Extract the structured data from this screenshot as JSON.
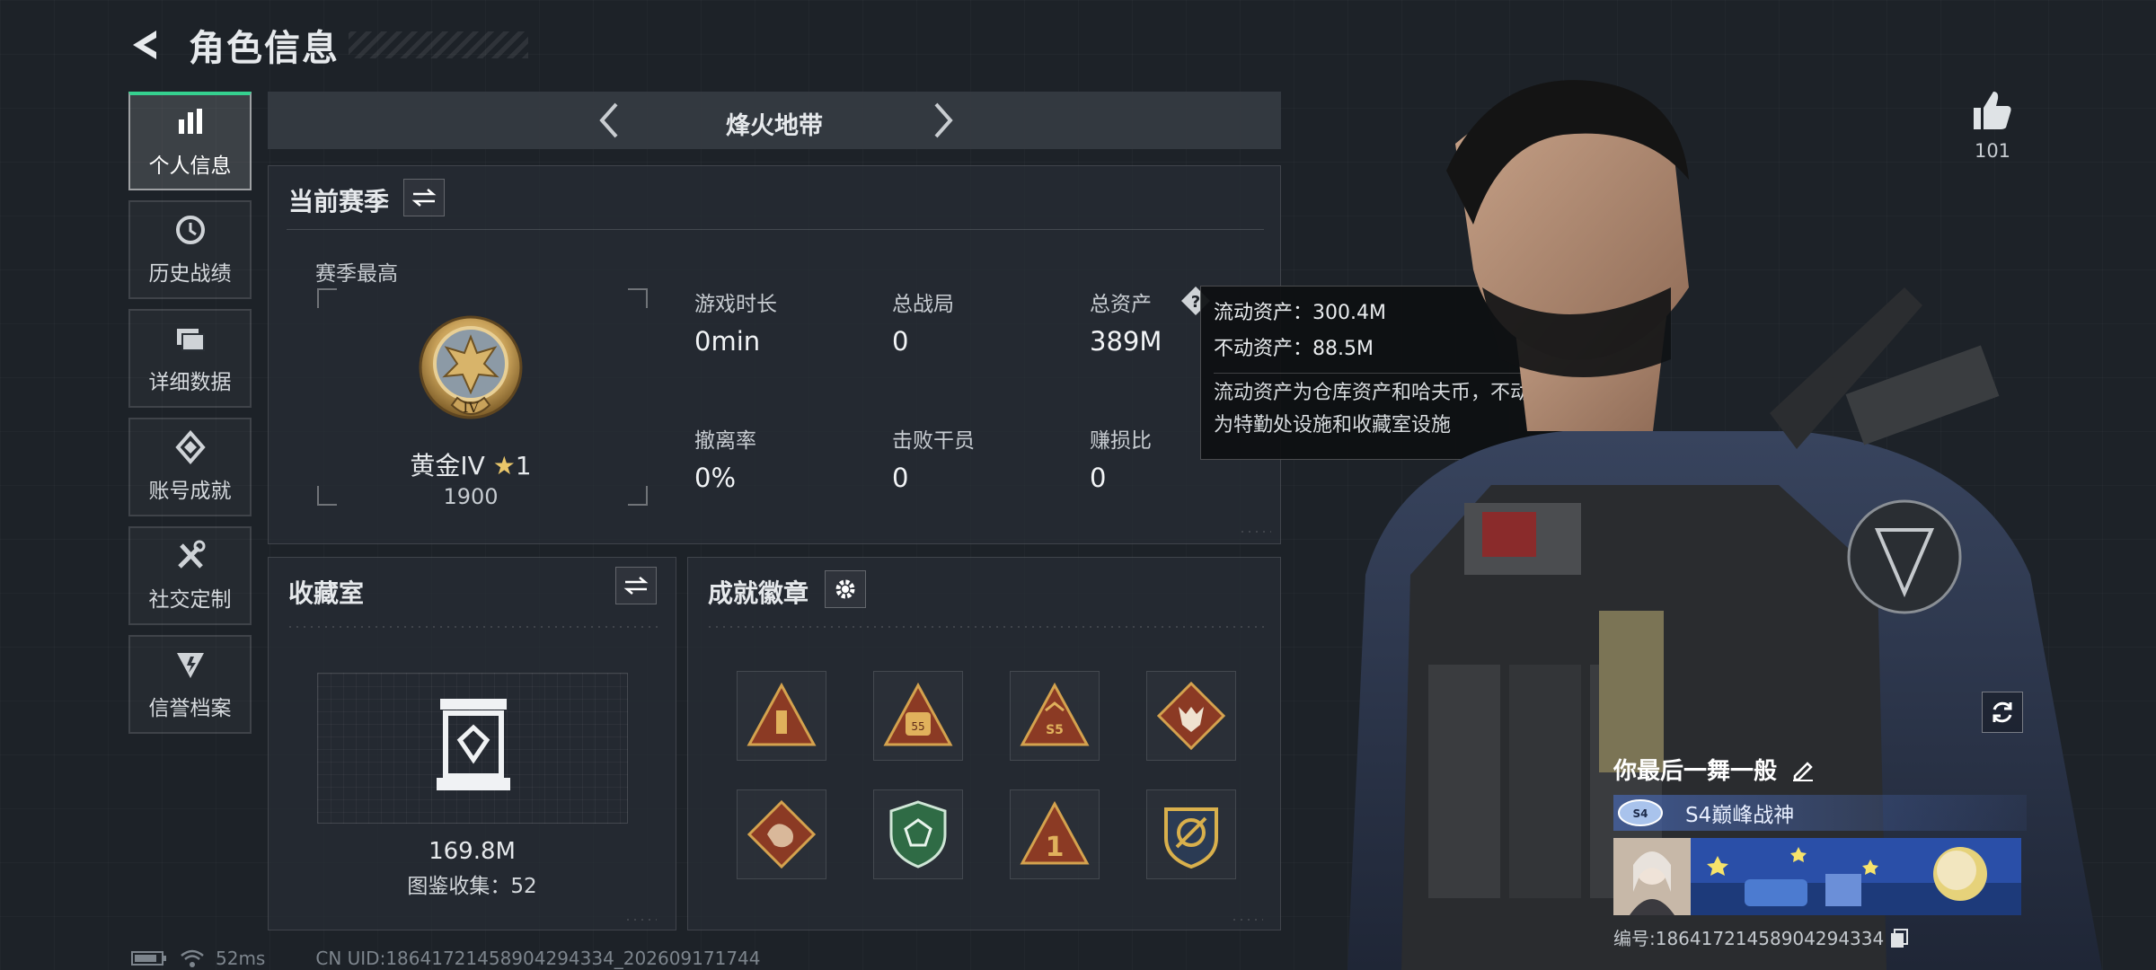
{
  "header": {
    "title": "角色信息"
  },
  "side_nav": {
    "items": [
      {
        "label": "个人信息",
        "icon": "bar-chart-icon",
        "active": true
      },
      {
        "label": "历史战绩",
        "icon": "clock-icon",
        "active": false
      },
      {
        "label": "详细数据",
        "icon": "folder-icon",
        "active": false
      },
      {
        "label": "账号成就",
        "icon": "achievement-icon",
        "active": false
      },
      {
        "label": "社交定制",
        "icon": "tools-icon",
        "active": false
      },
      {
        "label": "信誉档案",
        "icon": "reputation-icon",
        "active": false
      }
    ]
  },
  "mode_selector": {
    "title": "烽火地带"
  },
  "season": {
    "title": "当前赛季",
    "best_label": "赛季最高",
    "rank_name": "黄金IV",
    "rank_stars": "1",
    "rank_score": "1900",
    "rank_numeral": "IV",
    "stats": [
      {
        "label": "游戏时长",
        "value": "0min"
      },
      {
        "label": "总战局",
        "value": "0"
      },
      {
        "label": "总资产",
        "value": "389M"
      },
      {
        "label": "撤离率",
        "value": "0%"
      },
      {
        "label": "击败干员",
        "value": "0"
      },
      {
        "label": "赚损比",
        "value": "0"
      }
    ]
  },
  "tooltip": {
    "liquid": "流动资产：300.4M",
    "fixed": "不动资产：88.5M",
    "desc_line1": "流动资产为仓库资产和哈夫币，不动资产",
    "desc_line2": "为特勤处设施和收藏室设施"
  },
  "collection": {
    "title": "收藏室",
    "value": "169.8M",
    "catalog": "图鉴收集：52"
  },
  "achievements": {
    "title": "成就徽章",
    "badges": [
      {
        "icon": "ammo-badge-icon",
        "text": ""
      },
      {
        "icon": "backpack-badge-icon",
        "text": "55"
      },
      {
        "icon": "s5-badge-icon",
        "text": "S5"
      },
      {
        "icon": "wolf-badge-icon",
        "text": ""
      },
      {
        "icon": "dragon-badge-icon",
        "text": ""
      },
      {
        "icon": "shield-badge-icon",
        "text": ""
      },
      {
        "icon": "number-one-badge-icon",
        "text": "1"
      },
      {
        "icon": "crest-badge-icon",
        "text": ""
      }
    ]
  },
  "profile": {
    "likes": "101",
    "name": "你最后一舞一般",
    "title": "S4巅峰战神",
    "uid": "编号:18641721458904294334"
  },
  "status": {
    "ping": "52ms",
    "cn_uid": "CN UID:18641721458904294334_202609171744"
  },
  "colors": {
    "accent_green": "#35d08f",
    "gold": "#c9a25a",
    "background": "#1d2228"
  }
}
